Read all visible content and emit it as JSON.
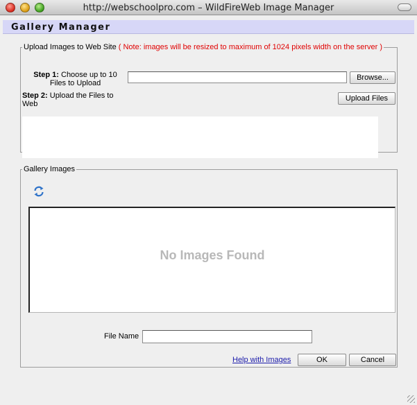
{
  "window": {
    "title": "http://webschoolpro.com – WildFireWeb Image Manager"
  },
  "header": {
    "title": "Gallery Manager"
  },
  "upload": {
    "legend": "Upload Images to Web Site",
    "note": "( Note: images will be resized to maximum of 1024 pixels width on the server )",
    "step1_label": "Step 1:",
    "step1_text": " Choose up to 10 Files to Upload",
    "step2_label": "Step 2:",
    "step2_text": " Upload the Files to Web",
    "browse_label": "Browse...",
    "upload_label": "Upload Files",
    "file_value": ""
  },
  "gallery": {
    "legend": "Gallery Images",
    "empty_message": "No Images Found",
    "filename_label": "File Name",
    "filename_value": "",
    "help_link": "Help with Images",
    "ok_label": "OK",
    "cancel_label": "Cancel"
  },
  "icons": {
    "refresh": "refresh-icon",
    "refresh_color": "#2f73c9"
  },
  "colors": {
    "header_bg": "#d7d7f7",
    "note": "#e00000",
    "link": "#1a1aaa"
  }
}
